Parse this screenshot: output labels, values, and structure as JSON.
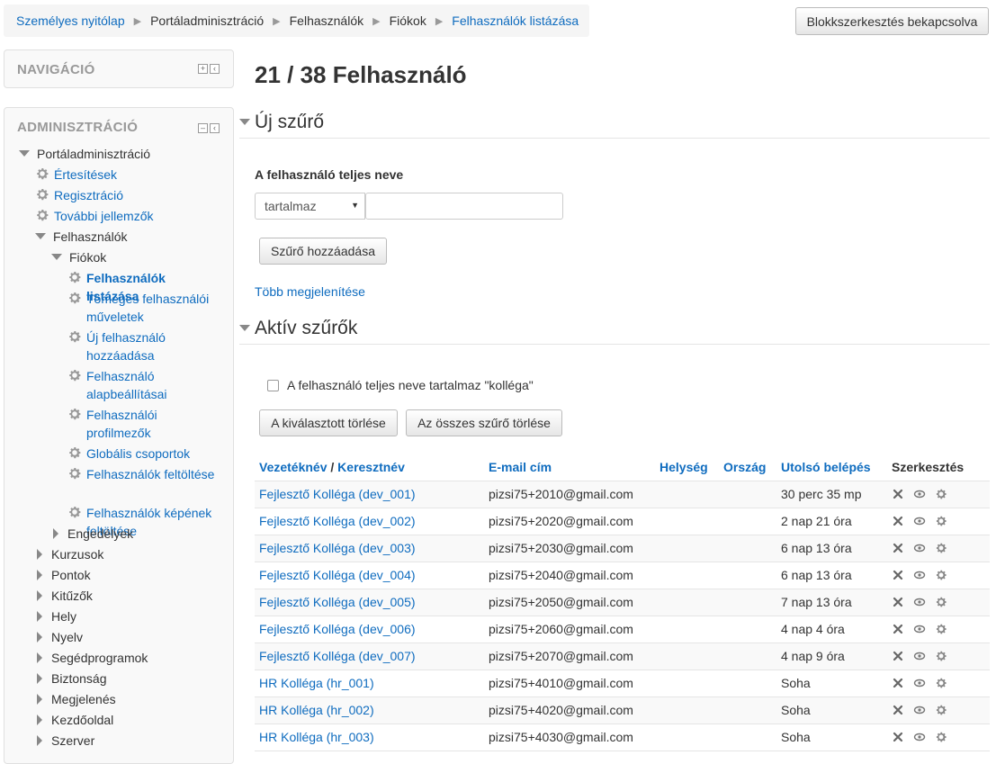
{
  "breadcrumb": [
    "Személyes nyitólap",
    "Portáladminisztráció",
    "Felhasználók",
    "Fiókok",
    "Felhasználók listázása"
  ],
  "block_edit_button": "Blokkszerkesztés bekapcsolva",
  "nav_block": {
    "title": "NAVIGÁCIÓ"
  },
  "admin_block": {
    "title": "ADMINISZTRÁCIÓ",
    "items": [
      {
        "label": "Portáladminisztráció",
        "type": "open"
      },
      {
        "label": "Értesítések",
        "type": "gear"
      },
      {
        "label": "Regisztráció",
        "type": "gear"
      },
      {
        "label": "További jellemzők",
        "type": "gear"
      },
      {
        "label": "Felhasználók",
        "type": "open"
      },
      {
        "label": "Fiókok",
        "type": "open"
      },
      {
        "label": "Felhasználók listázása",
        "type": "gear-active"
      },
      {
        "label": "Tömeges felhasználói műveletek",
        "type": "gear"
      },
      {
        "label": "Új felhasználó hozzáadása",
        "type": "gear"
      },
      {
        "label": "Felhasználó alapbeállításai",
        "type": "gear"
      },
      {
        "label": "Felhasználói profilmezők",
        "type": "gear"
      },
      {
        "label": "Globális csoportok",
        "type": "gear"
      },
      {
        "label": "Felhasználók feltöltése",
        "type": "gear"
      },
      {
        "label": "Felhasználók képének feltöltése",
        "type": "gear"
      },
      {
        "label": "Engedélyek",
        "type": "closed"
      },
      {
        "label": "Kurzusok",
        "type": "closed"
      },
      {
        "label": "Pontok",
        "type": "closed"
      },
      {
        "label": "Kitűzők",
        "type": "closed"
      },
      {
        "label": "Hely",
        "type": "closed"
      },
      {
        "label": "Nyelv",
        "type": "closed"
      },
      {
        "label": "Segédprogramok",
        "type": "closed"
      },
      {
        "label": "Biztonság",
        "type": "closed"
      },
      {
        "label": "Megjelenés",
        "type": "closed"
      },
      {
        "label": "Kezdőoldal",
        "type": "closed"
      },
      {
        "label": "Szerver",
        "type": "closed"
      }
    ]
  },
  "page_title": "21 / 38 Felhasználó",
  "new_filter": {
    "heading": "Új szűrő",
    "field_label": "A felhasználó teljes neve",
    "operator": "tartalmaz",
    "value": "",
    "add_button": "Szűrő hozzáadása",
    "more_link": "Több megjelenítése"
  },
  "active_filters": {
    "heading": "Aktív szűrők",
    "filter_text": "A felhasználó teljes neve tartalmaz \"kolléga\"",
    "remove_selected": "A kiválasztott törlése",
    "remove_all": "Az összes szűrő törlése"
  },
  "table": {
    "headers": {
      "lastname": "Vezetéknév",
      "slash": " / ",
      "firstname": "Keresztnév",
      "email": "E-mail cím",
      "city": "Helység",
      "country": "Ország",
      "lastaccess": "Utolsó belépés",
      "edit": "Szerkesztés"
    },
    "rows": [
      {
        "name": "Fejlesztő Kolléga (dev_001)",
        "email": "pizsi75+2010@gmail.com",
        "city": "",
        "country": "",
        "lastaccess": "30 perc 35 mp"
      },
      {
        "name": "Fejlesztő Kolléga (dev_002)",
        "email": "pizsi75+2020@gmail.com",
        "city": "",
        "country": "",
        "lastaccess": "2 nap 21 óra"
      },
      {
        "name": "Fejlesztő Kolléga (dev_003)",
        "email": "pizsi75+2030@gmail.com",
        "city": "",
        "country": "",
        "lastaccess": "6 nap 13 óra"
      },
      {
        "name": "Fejlesztő Kolléga (dev_004)",
        "email": "pizsi75+2040@gmail.com",
        "city": "",
        "country": "",
        "lastaccess": "6 nap 13 óra"
      },
      {
        "name": "Fejlesztő Kolléga (dev_005)",
        "email": "pizsi75+2050@gmail.com",
        "city": "",
        "country": "",
        "lastaccess": "7 nap 13 óra"
      },
      {
        "name": "Fejlesztő Kolléga (dev_006)",
        "email": "pizsi75+2060@gmail.com",
        "city": "",
        "country": "",
        "lastaccess": "4 nap 4 óra"
      },
      {
        "name": "Fejlesztő Kolléga (dev_007)",
        "email": "pizsi75+2070@gmail.com",
        "city": "",
        "country": "",
        "lastaccess": "4 nap 9 óra"
      },
      {
        "name": "HR Kolléga (hr_001)",
        "email": "pizsi75+4010@gmail.com",
        "city": "",
        "country": "",
        "lastaccess": "Soha"
      },
      {
        "name": "HR Kolléga (hr_002)",
        "email": "pizsi75+4020@gmail.com",
        "city": "",
        "country": "",
        "lastaccess": "Soha"
      },
      {
        "name": "HR Kolléga (hr_003)",
        "email": "pizsi75+4030@gmail.com",
        "city": "",
        "country": "",
        "lastaccess": "Soha"
      }
    ]
  }
}
